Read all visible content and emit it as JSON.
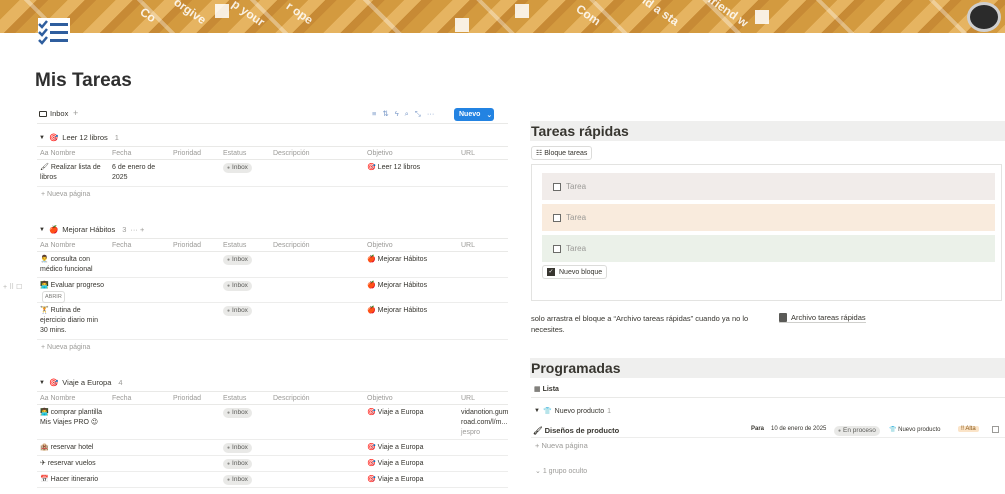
{
  "page": {
    "title": "Mis Tareas",
    "cover_words": [
      "Co",
      "orgive",
      "p your",
      "r ope",
      "Com",
      "ld a sta",
      "friend w"
    ]
  },
  "inbox": {
    "tab_label": "Inbox",
    "add": "+",
    "new_button": "Nuevo",
    "tools": [
      "≡",
      "⇅",
      "ϟ",
      "⌕",
      "⤡",
      "···"
    ],
    "columns": [
      "Aa Nombre",
      "Fecha",
      "Prioridad",
      "Estatus",
      "Descripción",
      "Objetivo",
      "URL"
    ],
    "new_page": "+ Nueva página",
    "groups": [
      {
        "name": "Leer 12 libros",
        "count": "1",
        "rows": [
          {
            "name": "Realizar lista de libros",
            "date": "6 de enero de 2025",
            "status": "Inbox",
            "objective": "Leer 12 libros",
            "url": ""
          }
        ]
      },
      {
        "name": "Mejorar Hábitos",
        "count": "3",
        "extra": "··· +",
        "rows": [
          {
            "name": "consulta con médico funcional",
            "date": "",
            "status": "Inbox",
            "objective": "Mejorar Hábitos",
            "url": ""
          },
          {
            "name": "Evaluar progreso",
            "date": "",
            "status": "Inbox",
            "objective": "Mejorar Hábitos",
            "url": "",
            "hover": "ABRIR"
          },
          {
            "name": "Rutina de ejercicio diario min 30 mins.",
            "date": "",
            "status": "Inbox",
            "objective": "Mejorar Hábitos",
            "url": ""
          }
        ]
      },
      {
        "name": "Viaje a Europa",
        "count": "4",
        "rows": [
          {
            "name": "comprar plantilla Mis Viajes PRO 😉",
            "date": "",
            "status": "Inbox",
            "objective": "Viaje a Europa",
            "url": "vidanotion.gumroad.com/l/m...",
            "url2": "jespro"
          },
          {
            "name": "reservar hotel",
            "date": "",
            "status": "Inbox",
            "objective": "Viaje a Europa",
            "url": ""
          },
          {
            "name": "reservar vuelos",
            "date": "",
            "status": "Inbox",
            "objective": "Viaje a Europa",
            "url": ""
          },
          {
            "name": "Hacer itinerario",
            "date": "",
            "status": "Inbox",
            "objective": "Viaje a Europa",
            "url": ""
          }
        ]
      }
    ],
    "hover_controls": "+ ⠿ ☐"
  },
  "quick": {
    "heading": "Tareas rápidas",
    "block_button": "Bloque tareas",
    "tasks": [
      {
        "label": "Tarea",
        "color": "#f1ecea"
      },
      {
        "label": "Tarea",
        "color": "#f9ebdd"
      },
      {
        "label": "Tarea",
        "color": "#ebf1e9"
      }
    ],
    "new_block": "Nuevo bloque",
    "note": "solo arrastra el bloque a “Archivo tareas rápidas” cuando ya no lo necesites.",
    "archive_link": "Archivo tareas rápidas"
  },
  "programadas": {
    "heading": "Programadas",
    "view": "Lista",
    "group": {
      "name": "Nuevo producto",
      "count": "1"
    },
    "row": {
      "name": "Diseños de producto",
      "para": "Para",
      "date": "10 de enero de 2025",
      "status": "En proceso",
      "product": "Nuevo producto",
      "priority": "Alta"
    },
    "new_page": "+ Nueva página",
    "hidden": "1 grupo oculto"
  },
  "colors": {
    "accent": "#2383e2"
  }
}
